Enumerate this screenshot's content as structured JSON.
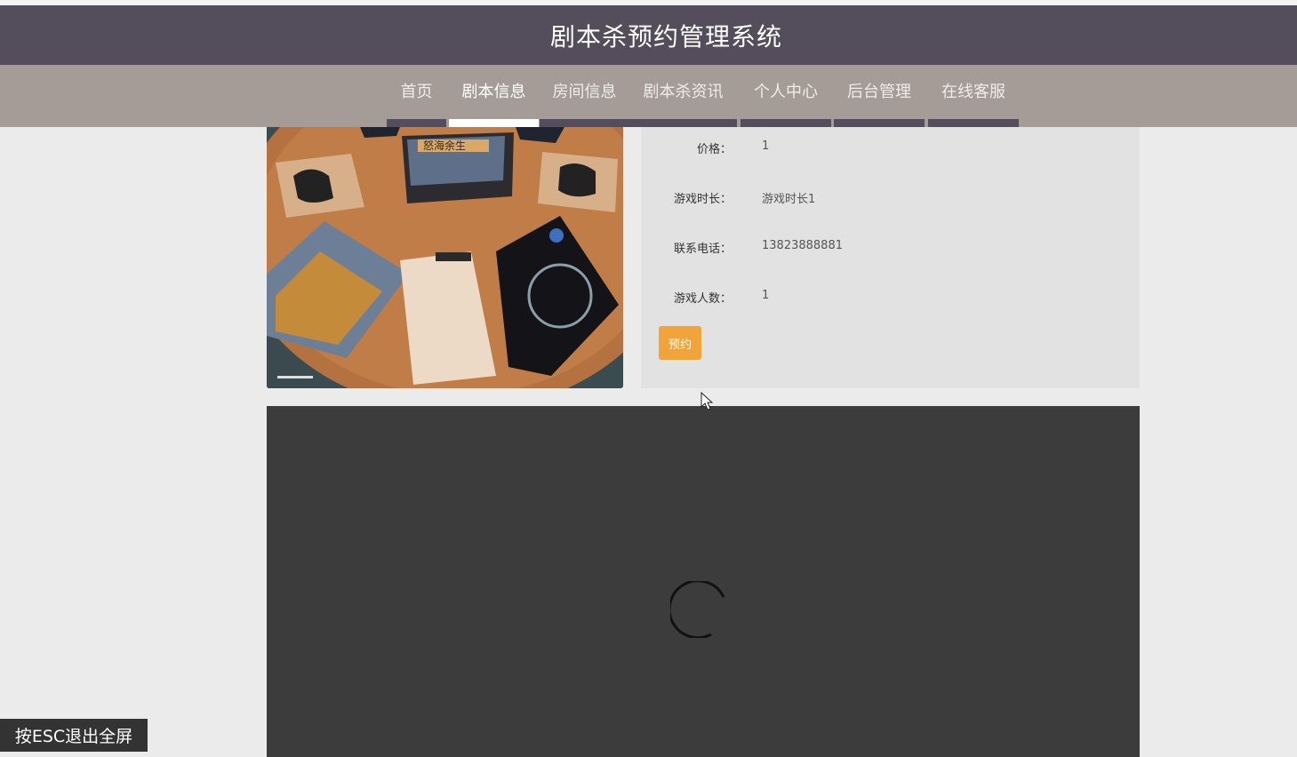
{
  "header": {
    "title": "剧本杀预约管理系统"
  },
  "nav": {
    "items": [
      {
        "label": "首页",
        "active": false
      },
      {
        "label": "剧本信息",
        "active": true
      },
      {
        "label": "房间信息",
        "active": false
      },
      {
        "label": "剧本杀资讯",
        "active": false
      },
      {
        "label": "个人中心",
        "active": false
      },
      {
        "label": "后台管理",
        "active": false
      },
      {
        "label": "在线客服",
        "active": false
      }
    ]
  },
  "detail": {
    "fields": [
      {
        "label": "价格：",
        "value": "1"
      },
      {
        "label": "游戏时长：",
        "value": "游戏时长1"
      },
      {
        "label": "联系电话：",
        "value": "13823888881"
      },
      {
        "label": "游戏人数：",
        "value": "1"
      }
    ],
    "book_label": "预约",
    "box_text": "怒海余生"
  },
  "video": {
    "state": "loading"
  },
  "fullscreen_tip": "按ESC退出全屏",
  "colors": {
    "header": "#534d5c",
    "navbar": "#a59c97",
    "accent": "#f0a43a",
    "page_bg": "#ebebeb",
    "panel_bg": "#e2e2e2",
    "video_bg": "#3c3c3c"
  }
}
